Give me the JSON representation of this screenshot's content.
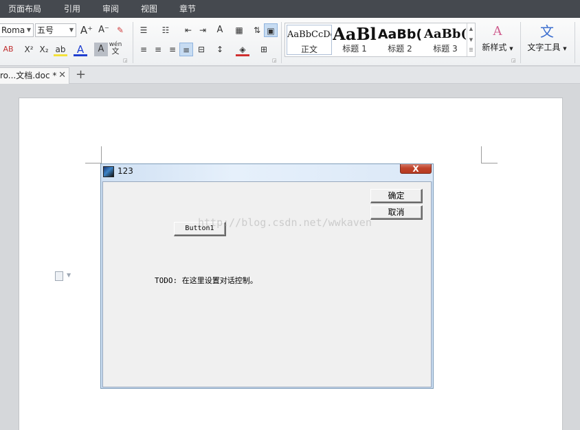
{
  "menu": [
    "页面布局",
    "引用",
    "审阅",
    "视图",
    "章节"
  ],
  "ribbon": {
    "font_name": "Roma",
    "font_size": "五号",
    "grow_font": "A⁺",
    "shrink_font": "A⁻",
    "strike_partial": "AB",
    "superscript": "X²",
    "subscript": "X₂",
    "font_color_letter": "A",
    "char_shade_letter": "A",
    "phonetic": "wén",
    "phonetic_char": "文",
    "styles": [
      {
        "preview": "AaBbCcDd",
        "label": "正文"
      },
      {
        "preview": "AaBl",
        "label": "标题 1"
      },
      {
        "preview": "AaBb(",
        "label": "标题 2"
      },
      {
        "preview": "AaBb(",
        "label": "标题 3"
      }
    ],
    "new_style": "新样式",
    "text_tools": "文字工具"
  },
  "tab": {
    "title": "ro...文档.doc *",
    "close": "✕",
    "new_tab": "+"
  },
  "dialog": {
    "title": "123",
    "close": "X",
    "ok": "确定",
    "cancel": "取消",
    "button1": "Button1",
    "todo": "TODO: 在这里设置对话控制。"
  },
  "watermark": "http://blog.csdn.net/wwkaven"
}
